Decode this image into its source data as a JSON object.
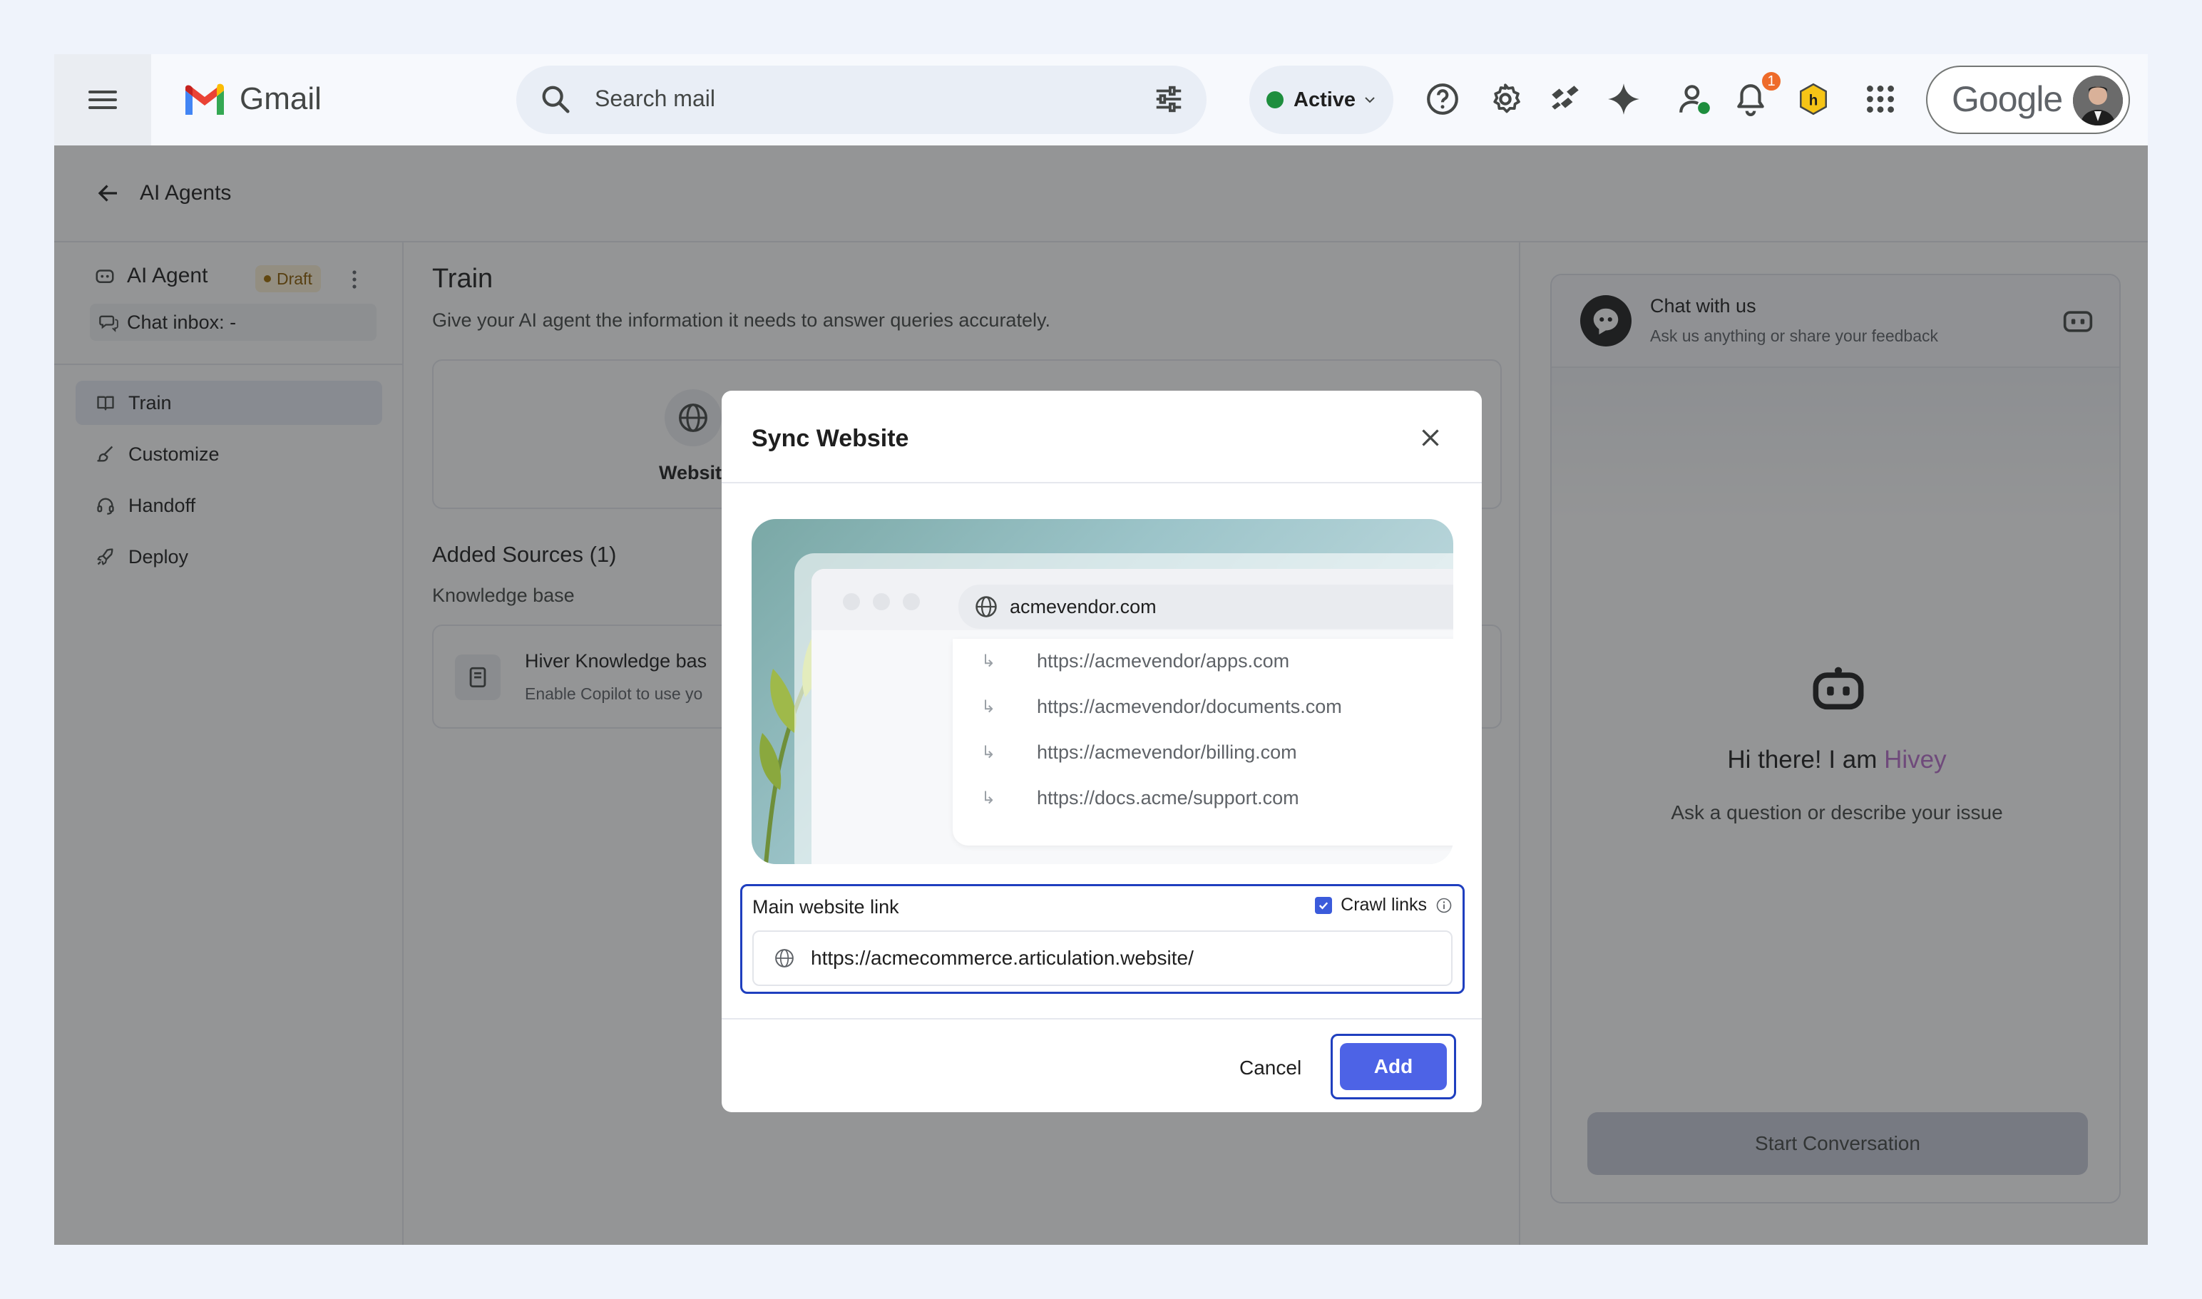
{
  "gmail": {
    "logo_text": "Gmail",
    "search_placeholder": "Search mail",
    "status_label": "Active",
    "notification_count": "1",
    "account_brand": "Google"
  },
  "app": {
    "back_title": "AI Agents",
    "agent_name": "AI Agent",
    "agent_status": "Draft",
    "chat_inbox": "Chat inbox: -",
    "nav": [
      {
        "label": "Train"
      },
      {
        "label": "Customize"
      },
      {
        "label": "Handoff"
      },
      {
        "label": "Deploy"
      }
    ],
    "train_title": "Train",
    "train_subtitle": "Give your AI agent the information it needs to answer queries accurately.",
    "source_card_label": "Websit",
    "added_sources": "Added Sources (1)",
    "knowledge_base_label": "Knowledge base",
    "kb_item_title": "Hiver Knowledge bas",
    "kb_item_sub": "Enable Copilot to use yo"
  },
  "chat_widget": {
    "title": "Chat with us",
    "subtitle": "Ask us anything or share your feedback",
    "greeting_prefix": "Hi there! I am ",
    "bot_name": "Hivey",
    "prompt": "Ask a question or describe your issue",
    "start_button": "Start Conversation"
  },
  "modal": {
    "title": "Sync Website",
    "illustration": {
      "domain": "acmevendor.com",
      "links": [
        "https://acmevendor/apps.com",
        "https://acmevendor/documents.com",
        "https://acmevendor/billing.com",
        "https://docs.acme/support.com"
      ]
    },
    "field_label": "Main website link",
    "crawl_label": "Crawl links",
    "crawl_checked": true,
    "url_value": "https://acmecommerce.articulation.website/",
    "cancel_label": "Cancel",
    "add_label": "Add"
  },
  "colors": {
    "primary": "#4d63e6",
    "focus_border": "#1f3fbf",
    "active_dot": "#1e8e3e",
    "badge": "#ee6b2a",
    "hivey": "#b86fcb"
  }
}
